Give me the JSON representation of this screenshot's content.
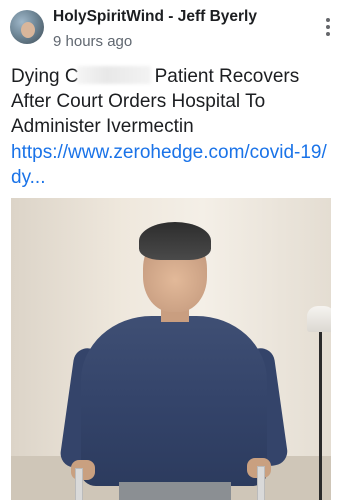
{
  "post": {
    "author": "HolySpiritWind - Jeff Byerly",
    "time": "9 hours ago",
    "text_part1": "Dying C",
    "text_part2": "Patient Recovers After Court Orders Hospital To Administer Ivermectin",
    "link": "https://www.zerohedge.com/covid-19/dy...",
    "more_icon": "more-vertical-icon"
  },
  "colors": {
    "link": "#1a73e8",
    "text": "#1c1e21",
    "secondary_text": "#606770",
    "sweater": "#3f4f74"
  }
}
